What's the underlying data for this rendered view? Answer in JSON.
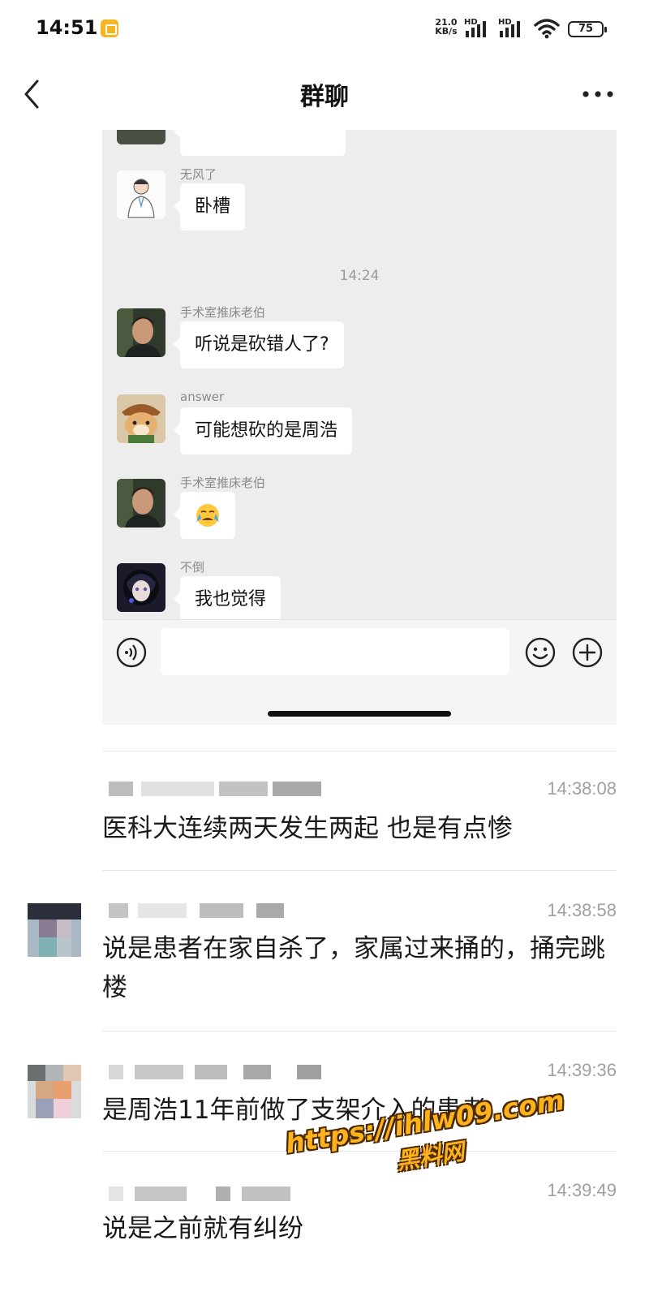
{
  "status_bar": {
    "time": "14:51",
    "network_speed_value": "21.0",
    "network_speed_unit": "KB/s",
    "hd_label": "HD",
    "battery": "75",
    "icons": [
      "app-notification-icon",
      "signal-icon",
      "signal-icon",
      "wifi-icon",
      "battery-icon"
    ]
  },
  "title_bar": {
    "title": "群聊",
    "back_icon": "chevron-left-icon",
    "more_icon": "more-dots-icon"
  },
  "embedded_chat": {
    "timestamp": "14:24",
    "messages": [
      {
        "sender": "",
        "text": "",
        "avatar": "partial-avatar"
      },
      {
        "sender": "无风了",
        "text": "卧槽",
        "avatar": "doctor-cartoon-avatar"
      },
      {
        "sender": "手术室推床老伯",
        "text": "听说是砍错人了?",
        "avatar": "man-photo-avatar"
      },
      {
        "sender": "answer",
        "text": "可能想砍的是周浩",
        "avatar": "dog-photo-avatar"
      },
      {
        "sender": "手术室推床老伯",
        "text": "😭",
        "avatar": "man-photo-avatar"
      },
      {
        "sender": "不倒",
        "text": "我也觉得",
        "avatar": "anime-dark-avatar"
      }
    ],
    "input_icons": [
      "voice-icon",
      "emoji-icon",
      "plus-icon"
    ],
    "input_placeholder": ""
  },
  "comments": [
    {
      "name": "",
      "time": "14:38:08",
      "text": "医科大连续两天发生两起 也是有点惨"
    },
    {
      "name": "",
      "time": "14:38:58",
      "text": "说是患者在家自杀了，家属过来捅的，捅完跳楼"
    },
    {
      "name": "",
      "time": "14:39:36",
      "text": "是周浩11年前做了支架介入的患者"
    },
    {
      "name": "",
      "time": "14:39:49",
      "text": "说是之前就有纠纷"
    }
  ],
  "watermark": {
    "url": "https://ihlw09.com",
    "site": "黑料网"
  },
  "colors": {
    "watermark_fill": "#ffb21c",
    "chat_background": "#ededed",
    "bubble": "#ffffff",
    "timestamp_text": "#a0a0a0"
  }
}
